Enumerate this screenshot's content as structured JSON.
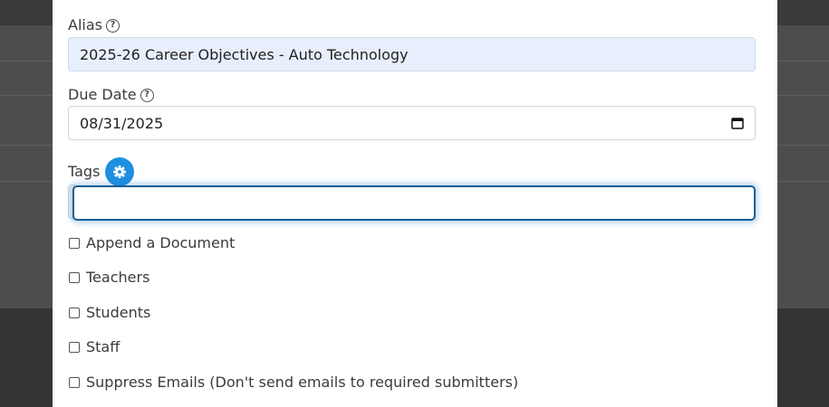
{
  "form": {
    "alias": {
      "label": "Alias",
      "value": "2025-26 Career Objectives - Auto Technology"
    },
    "due_date": {
      "label": "Due Date",
      "value": "08/31/2025"
    },
    "tags": {
      "label": "Tags",
      "value": ""
    },
    "checkboxes": [
      {
        "label": "Append a Document",
        "checked": false
      },
      {
        "label": "Teachers",
        "checked": false
      },
      {
        "label": "Students",
        "checked": false
      },
      {
        "label": "Staff",
        "checked": false
      },
      {
        "label": "Suppress Emails (Don't send emails to required submitters)",
        "checked": false
      }
    ]
  },
  "colors": {
    "accent": "#1e8fe0",
    "focus_border": "#1a5e95",
    "autofill_bg": "#e8effc",
    "backdrop": "#4d4d4d"
  },
  "icons": {
    "help": "help-circle-icon",
    "calendar": "calendar-icon",
    "gear": "gear-icon"
  }
}
